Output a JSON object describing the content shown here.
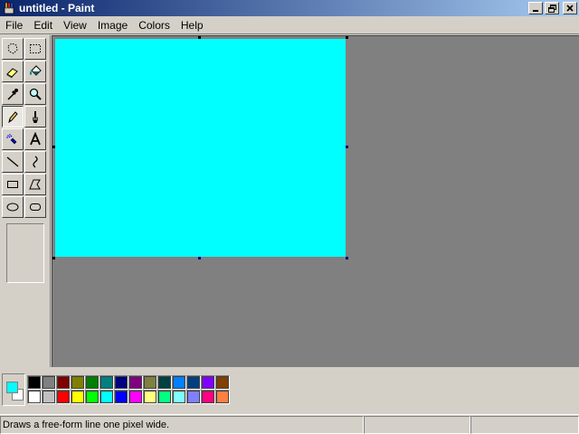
{
  "window": {
    "title": "untitled - Paint",
    "app_icon": "paint-icon",
    "controls": [
      {
        "name": "minimize-button",
        "glyph": "_"
      },
      {
        "name": "restore-button",
        "glyph": "❐"
      },
      {
        "name": "close-button",
        "glyph": "✕"
      }
    ]
  },
  "menu": {
    "items": [
      "File",
      "Edit",
      "View",
      "Image",
      "Colors",
      "Help"
    ]
  },
  "toolbox": {
    "tools": [
      {
        "name": "free-form-select-icon",
        "pressed": false
      },
      {
        "name": "select-icon",
        "pressed": false
      },
      {
        "name": "eraser-icon",
        "pressed": false
      },
      {
        "name": "fill-with-color-icon",
        "pressed": false
      },
      {
        "name": "pick-color-icon",
        "pressed": false
      },
      {
        "name": "magnifier-icon",
        "pressed": false
      },
      {
        "name": "pencil-icon",
        "pressed": true
      },
      {
        "name": "brush-icon",
        "pressed": false
      },
      {
        "name": "airbrush-icon",
        "pressed": false
      },
      {
        "name": "text-icon",
        "pressed": false
      },
      {
        "name": "line-icon",
        "pressed": false
      },
      {
        "name": "curve-icon",
        "pressed": false
      },
      {
        "name": "rectangle-icon",
        "pressed": false
      },
      {
        "name": "polygon-icon",
        "pressed": false
      },
      {
        "name": "ellipse-icon",
        "pressed": false
      },
      {
        "name": "rounded-rectangle-icon",
        "pressed": false
      }
    ]
  },
  "canvas": {
    "fill_color": "#00ffff"
  },
  "palette": {
    "foreground": "#00ffff",
    "background": "#ffffff",
    "colors_row1": [
      "#000000",
      "#808080",
      "#800000",
      "#808000",
      "#008000",
      "#008080",
      "#000080",
      "#800080",
      "#808040",
      "#004040",
      "#0080ff",
      "#004080",
      "#8000ff",
      "#804000"
    ],
    "colors_row2": [
      "#ffffff",
      "#c0c0c0",
      "#ff0000",
      "#ffff00",
      "#00ff00",
      "#00ffff",
      "#0000ff",
      "#ff00ff",
      "#ffff80",
      "#00ff80",
      "#80ffff",
      "#8080ff",
      "#ff0080",
      "#ff8040"
    ]
  },
  "status": {
    "message": "Draws a free-form line one pixel wide.",
    "coords": "",
    "size": ""
  }
}
